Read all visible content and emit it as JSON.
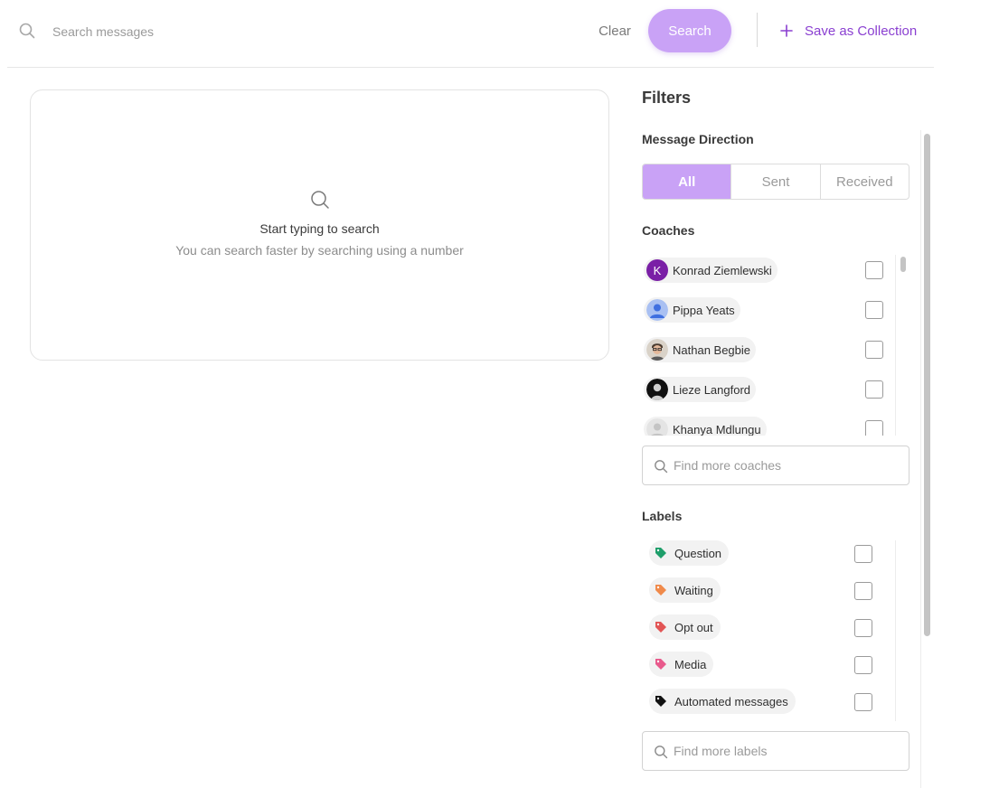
{
  "search": {
    "placeholder": "Search messages",
    "clear_label": "Clear",
    "search_label": "Search",
    "save_collection_label": "Save as Collection"
  },
  "empty_state": {
    "title": "Start typing to search",
    "subtitle": "You can search faster by searching using a number"
  },
  "filters": {
    "title": "Filters",
    "direction": {
      "label": "Message Direction",
      "options": [
        "All",
        "Sent",
        "Received"
      ],
      "selected": "All"
    },
    "coaches": {
      "label": "Coaches",
      "items": [
        {
          "name": "Konrad Ziemlewski",
          "avatar": "K",
          "avatar_type": "letter",
          "avatar_color": "#7a1fa6"
        },
        {
          "name": "Pippa Yeats",
          "avatar_type": "generic-person-blue"
        },
        {
          "name": "Nathan Begbie",
          "avatar_type": "photo-glasses"
        },
        {
          "name": "Lieze Langford",
          "avatar_type": "photo-dark"
        },
        {
          "name": "Khanya Mdlungu",
          "avatar_type": "generic-person-grey"
        }
      ],
      "find_placeholder": "Find more coaches"
    },
    "labels": {
      "label": "Labels",
      "items": [
        {
          "name": "Question",
          "color": "#1e9e6a"
        },
        {
          "name": "Waiting",
          "color": "#f08a4b"
        },
        {
          "name": "Opt out",
          "color": "#e25555"
        },
        {
          "name": "Media",
          "color": "#e85a8c"
        },
        {
          "name": "Automated messages",
          "color": "#111111"
        }
      ],
      "find_placeholder": "Find more labels"
    }
  },
  "colors": {
    "accent": "#c9a2f6",
    "accent_text": "#8a3fd1"
  }
}
